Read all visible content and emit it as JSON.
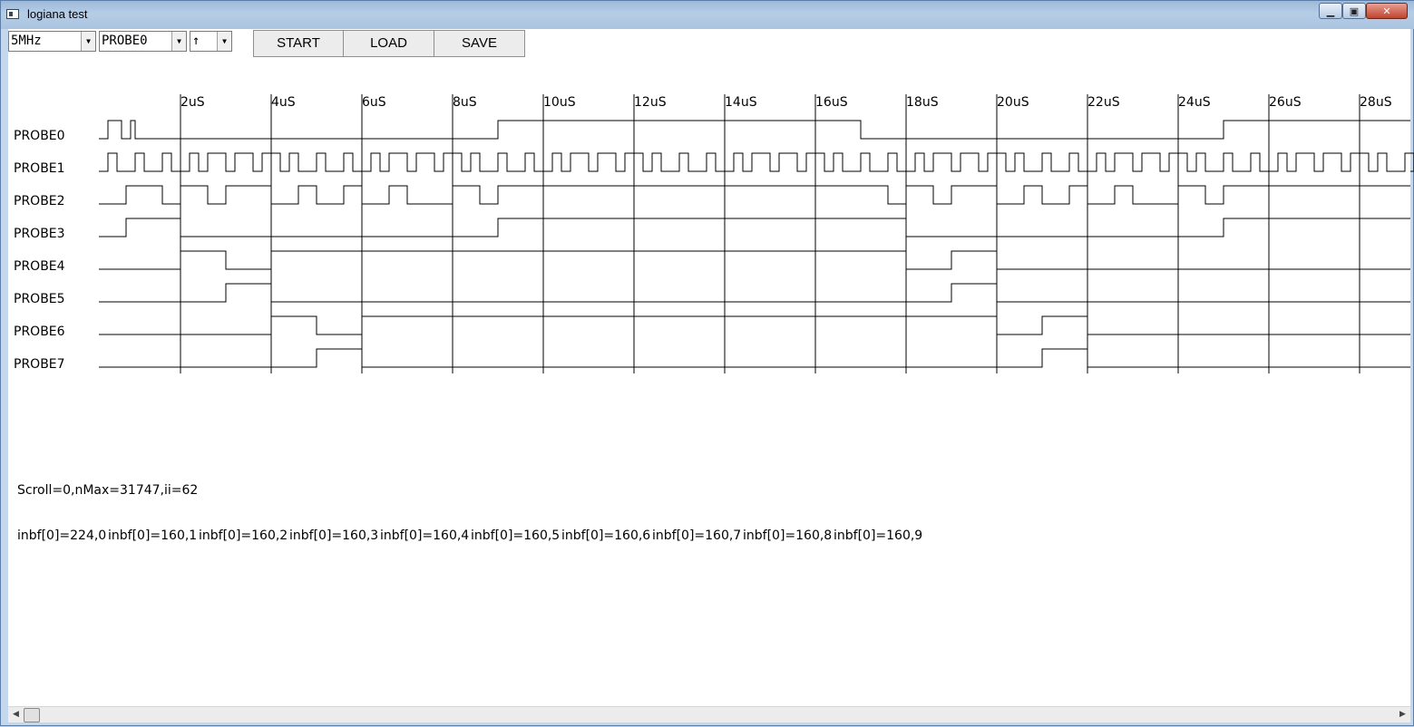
{
  "window": {
    "title": "logiana test",
    "minimize_glyph": "▁",
    "maximize_glyph": "▣",
    "close_glyph": "✕"
  },
  "toolbar": {
    "frequency": "5MHz",
    "trigger_probe": "PROBE0",
    "edge": "↑",
    "start_label": "START",
    "load_label": "LOAD",
    "save_label": "SAVE",
    "dropdown_glyph": "▼"
  },
  "timeline": {
    "labels": [
      "2uS",
      "4uS",
      "6uS",
      "8uS",
      "10uS",
      "12uS",
      "14uS",
      "16uS",
      "18uS",
      "20uS",
      "22uS",
      "24uS",
      "26uS",
      "28uS"
    ]
  },
  "probes": [
    "PROBE0",
    "PROBE1",
    "PROBE2",
    "PROBE3",
    "PROBE4",
    "PROBE5",
    "PROBE6",
    "PROBE7"
  ],
  "waveforms": {
    "unit": "0.1uS",
    "initial_low": true,
    "transitions": [
      [
        1,
        2.5,
        3.5,
        4,
        44,
        84,
        124
      ],
      [
        1,
        2,
        4,
        5,
        7,
        8,
        10,
        11,
        12,
        14,
        15,
        17,
        18,
        20,
        21,
        22,
        24,
        25,
        27,
        28,
        30,
        31,
        32,
        34,
        35,
        37,
        38,
        40,
        41,
        42,
        44,
        45,
        47,
        48,
        50,
        51,
        52,
        54,
        55,
        57,
        58,
        60,
        61,
        62,
        64,
        65,
        67,
        68,
        70,
        71,
        72,
        74,
        75,
        77,
        78,
        80,
        81,
        82,
        84,
        85,
        87,
        88,
        90,
        91,
        92,
        94,
        95,
        97,
        98,
        100,
        101,
        102,
        104,
        105,
        107,
        108,
        110,
        111,
        112,
        114,
        115,
        117,
        118,
        120,
        121,
        122,
        124,
        125,
        127,
        128,
        130,
        131,
        132,
        134,
        135,
        137,
        138,
        140,
        141,
        142,
        144,
        145
      ],
      [
        3,
        7,
        9,
        12,
        14,
        19,
        22,
        24,
        27,
        29,
        32,
        34,
        39,
        42,
        44,
        87,
        89,
        92,
        94,
        99,
        102,
        104,
        107,
        109,
        112,
        114,
        119,
        122,
        124
      ],
      [
        3,
        9,
        44,
        89,
        124
      ],
      [
        9,
        14,
        19,
        89,
        94,
        99
      ],
      [
        14,
        19,
        94,
        99
      ],
      [
        19,
        24,
        29,
        99,
        104,
        109
      ],
      [
        24,
        29,
        104,
        109
      ]
    ]
  },
  "status": {
    "scroll": "Scroll=0,nMax=31747,ii=62",
    "inbf": [
      "inbf[0]=224,0",
      "inbf[0]=160,1",
      "inbf[0]=160,2",
      "inbf[0]=160,3",
      "inbf[0]=160,4",
      "inbf[0]=160,5",
      "inbf[0]=160,6",
      "inbf[0]=160,7",
      "inbf[0]=160,8",
      "inbf[0]=160,9"
    ]
  },
  "scrollbar": {
    "left_glyph": "◀",
    "right_glyph": "▶"
  }
}
